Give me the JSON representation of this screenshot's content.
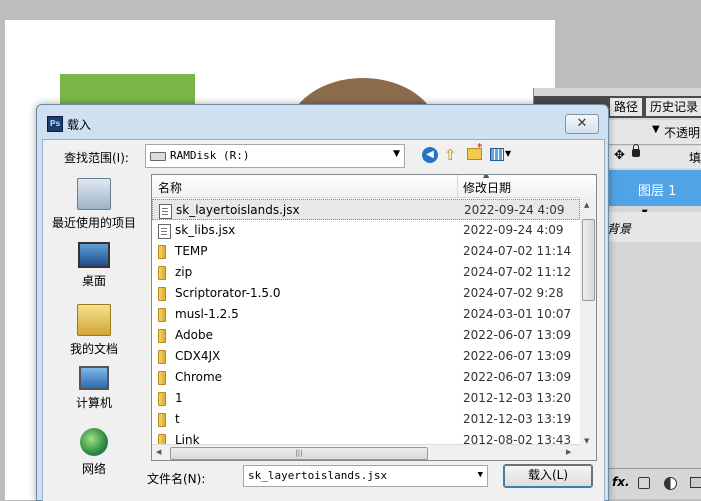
{
  "photoshop": {
    "panel_tabs": [
      "路径",
      "历史记录"
    ],
    "opacity_label": "不透明",
    "fill_label": "填",
    "layers": [
      {
        "label": "图层 1"
      },
      {
        "label": "背景"
      }
    ],
    "colors": {
      "green_shape": "#7ab648",
      "brown_shape": "#8a6c4b",
      "selected_layer": "#4fa3e6"
    }
  },
  "dialog": {
    "title": "载入",
    "close_label": "✕",
    "look_in": {
      "label": "查找范围(I):",
      "value": "RAMDisk (R:)"
    },
    "places": [
      {
        "label": "最近使用的项目"
      },
      {
        "label": "桌面"
      },
      {
        "label": "我的文档"
      },
      {
        "label": "计算机"
      },
      {
        "label": "网络"
      }
    ],
    "columns": {
      "name": "名称",
      "date": "修改日期"
    },
    "files": [
      {
        "name": "sk_layertoislands.jsx",
        "date": "2022-09-24 4:09",
        "kind": "file"
      },
      {
        "name": "sk_libs.jsx",
        "date": "2022-09-24 4:09",
        "kind": "file"
      },
      {
        "name": "TEMP",
        "date": "2024-07-02 11:14",
        "kind": "folder"
      },
      {
        "name": "zip",
        "date": "2024-07-02 11:12",
        "kind": "folder"
      },
      {
        "name": "Scriptorator-1.5.0",
        "date": "2024-07-02 9:28",
        "kind": "folder"
      },
      {
        "name": "musl-1.2.5",
        "date": "2024-03-01 10:07",
        "kind": "folder"
      },
      {
        "name": "Adobe",
        "date": "2022-06-07 13:09",
        "kind": "folder"
      },
      {
        "name": "CDX4JX",
        "date": "2022-06-07 13:09",
        "kind": "folder"
      },
      {
        "name": "Chrome",
        "date": "2022-06-07 13:09",
        "kind": "folder"
      },
      {
        "name": "1",
        "date": "2012-12-03 13:20",
        "kind": "folder"
      },
      {
        "name": "t",
        "date": "2012-12-03 13:19",
        "kind": "folder"
      },
      {
        "name": "Link",
        "date": "2012-08-02 13:43",
        "kind": "folder"
      }
    ],
    "filename": {
      "label": "文件名(N):",
      "value": "sk_layertoislands.jsx"
    },
    "load_button": "载入(L)"
  }
}
